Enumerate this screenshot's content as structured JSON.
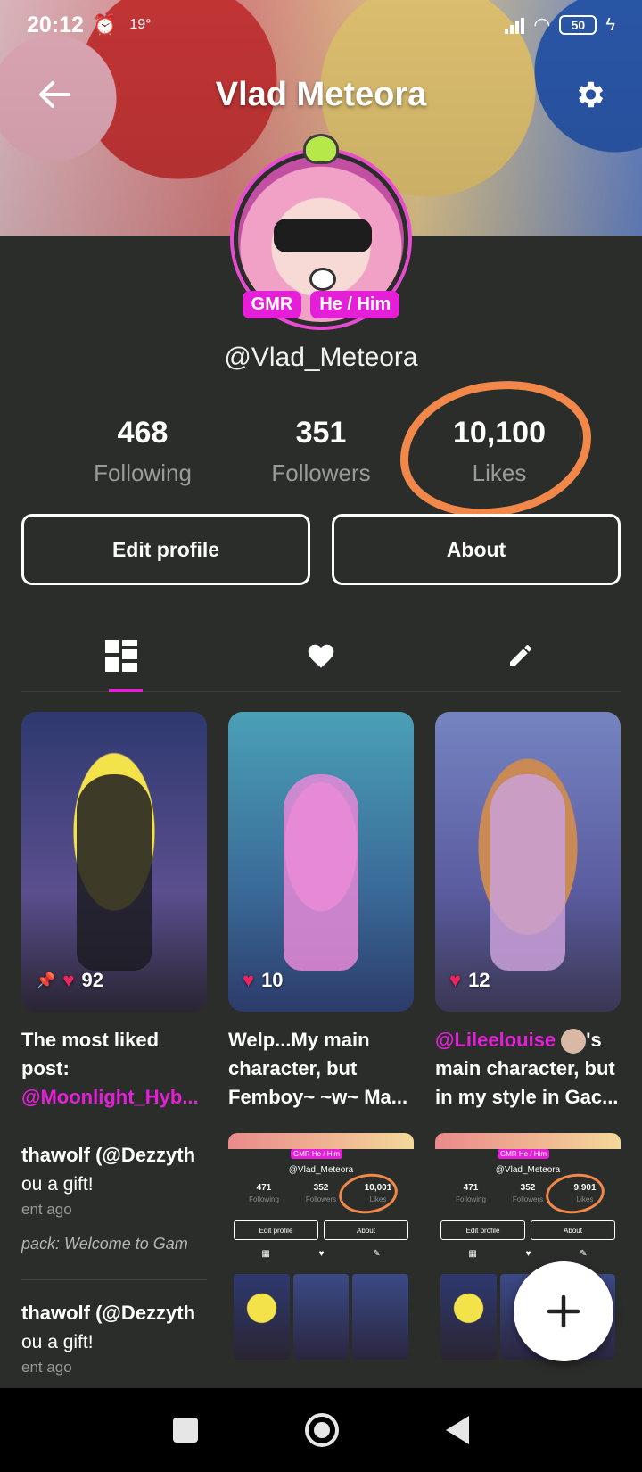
{
  "status_bar": {
    "time": "20:12",
    "temperature": "19°",
    "battery": "50"
  },
  "header": {
    "title": "Vlad Meteora"
  },
  "profile": {
    "badges": [
      "GMR",
      "He / Him"
    ],
    "username": "@Vlad_Meteora",
    "stats": [
      {
        "value": "468",
        "label": "Following"
      },
      {
        "value": "351",
        "label": "Followers"
      },
      {
        "value": "10,100",
        "label": "Likes"
      }
    ],
    "buttons": {
      "edit": "Edit profile",
      "about": "About"
    }
  },
  "tabs": [
    {
      "icon": "grid-icon",
      "active": true
    },
    {
      "icon": "heart-icon",
      "active": false
    },
    {
      "icon": "pencil-icon",
      "active": false
    }
  ],
  "posts": [
    {
      "likes": "92",
      "pinned": true,
      "caption_plain": "The most liked post: ",
      "caption_mention": "@Moonlight_Hyb...",
      "caption_suffix": ""
    },
    {
      "likes": "10",
      "pinned": false,
      "caption_plain": "Welp...My main character, but Femboy~ ~w~ Ma...",
      "caption_mention": "",
      "caption_suffix": ""
    },
    {
      "likes": "12",
      "pinned": false,
      "caption_plain": "",
      "caption_mention": "@Lileelouise",
      "caption_suffix": "'s main character, but in my style in Gac..."
    }
  ],
  "feed": [
    {
      "line1": "thawolf (@Dezzyth",
      "line2": "ou a gift!",
      "line3": "ent ago",
      "line4": "pack: Welcome to Gam"
    },
    {
      "line1": "thawolf (@Dezzyth",
      "line2": "ou a gift!",
      "line3": "ent ago"
    }
  ],
  "screenshots": [
    {
      "badges": "GMR He / Him",
      "username": "@Vlad_Meteora",
      "stats": [
        {
          "value": "471",
          "label": "Following"
        },
        {
          "value": "352",
          "label": "Followers"
        },
        {
          "value": "10,001",
          "label": "Likes"
        }
      ],
      "edit": "Edit profile",
      "about": "About"
    },
    {
      "badges": "GMR He / Him",
      "username": "@Vlad_Meteora",
      "stats": [
        {
          "value": "471",
          "label": "Following"
        },
        {
          "value": "352",
          "label": "Followers"
        },
        {
          "value": "9,901",
          "label": "Likes"
        }
      ],
      "edit": "Edit profile",
      "about": "About"
    }
  ],
  "fab": {
    "icon": "plus-icon"
  },
  "colors": {
    "accent": "#e51fd8",
    "highlight": "#f2874a",
    "background": "#2b2d2a",
    "like": "#f0245c"
  }
}
